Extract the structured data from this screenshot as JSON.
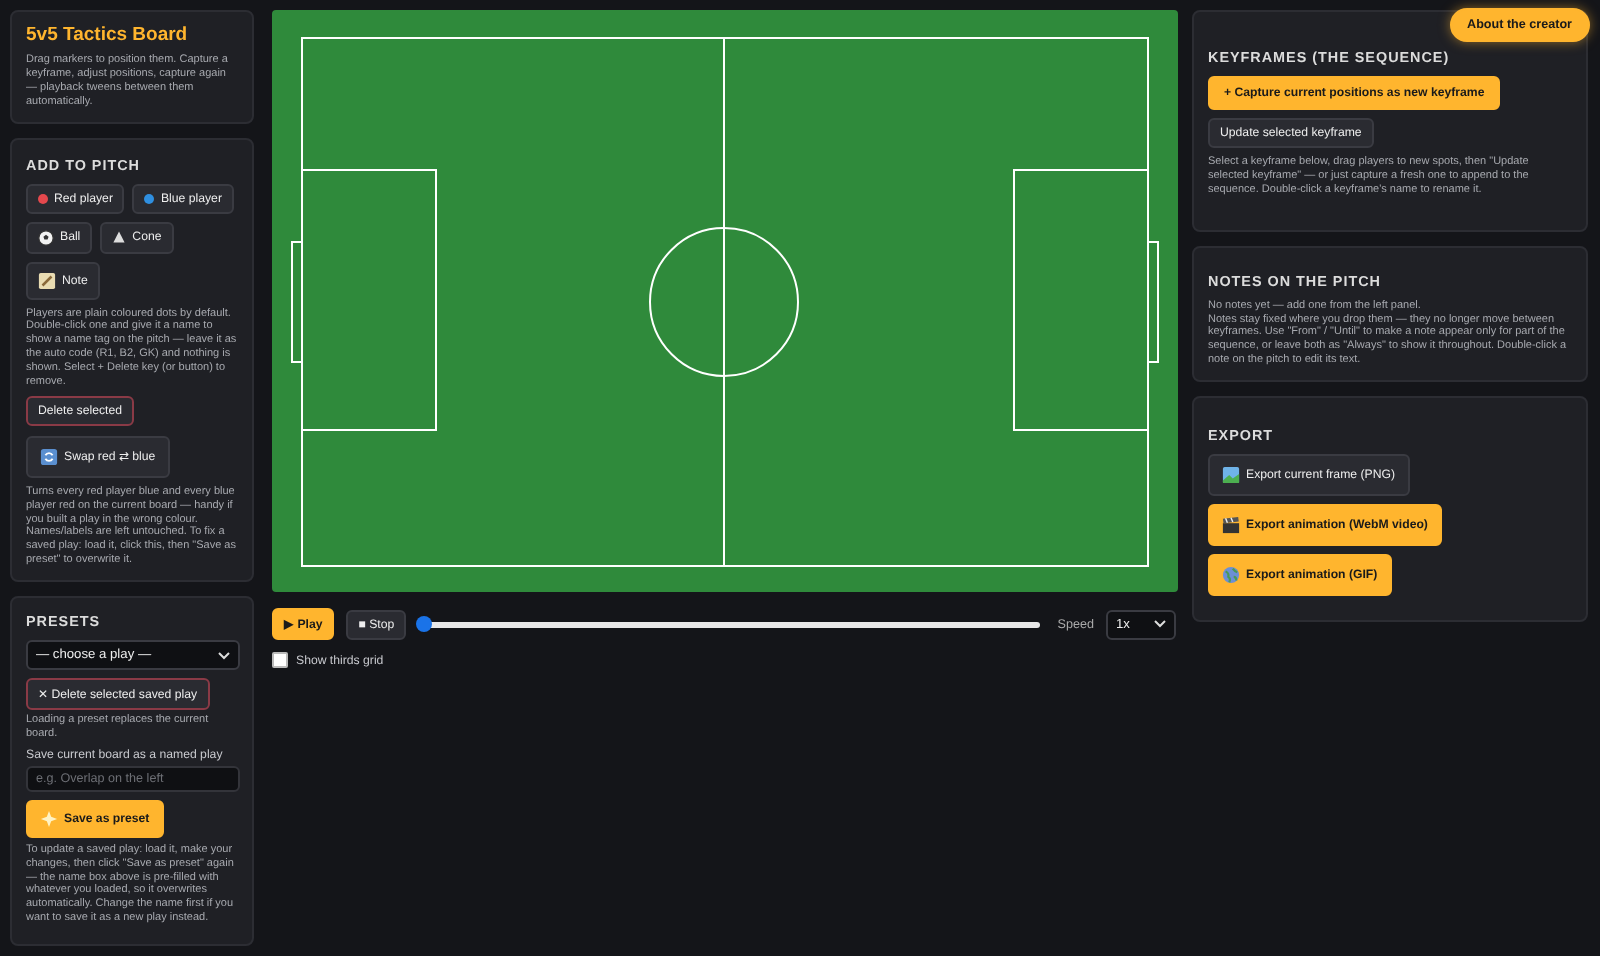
{
  "intro": {
    "title": "5v5 Tactics Board",
    "text": "Drag markers to position them. Capture a keyframe, adjust positions, capture again — playback tweens between them automatically."
  },
  "add_to_pitch": {
    "heading": "ADD TO PITCH",
    "buttons": [
      {
        "label": "Red player",
        "kind": "dot",
        "color": "#e5484d"
      },
      {
        "label": "Blue player",
        "kind": "dot",
        "color": "#2f8fe0"
      },
      {
        "label": "Ball",
        "kind": "ball"
      },
      {
        "label": "Cone",
        "kind": "cone"
      },
      {
        "label": "Note",
        "kind": "note"
      }
    ],
    "help": "Players are plain coloured dots by default. Double-click one and give it a name to show a name tag on the pitch — leave it as the auto code (R1, B2, GK) and nothing is shown. Select + Delete key (or button) to remove.",
    "delete_button": "Delete selected",
    "swap_button": "Swap red ⇄ blue",
    "swap_help": "Turns every red player blue and every blue player red on the current board — handy if you built a play in the wrong colour. Names/labels are left untouched. To fix a saved play: load it, click this, then \"Save as preset\" to overwrite it."
  },
  "presets": {
    "heading": "PRESETS",
    "select": "— choose a play —",
    "delete_button": "✕ Delete selected saved play",
    "delete_help": "Loading a preset replaces the current board.",
    "save_label": "Save current board as a named play",
    "name_field": {
      "placeholder": "e.g. Overlap on the left"
    },
    "save_button": "Save as preset",
    "help": "To update a saved play: load it, make your changes, then click \"Save as preset\" again — the name box above is pre-filled with whatever you loaded, so it overwrites automatically. Change the name first if you want to save it as a new play instead."
  },
  "playback": {
    "play_button": "▶ Play",
    "stop_button": "■ Stop",
    "timeline": {
      "level": 0
    },
    "speed_label": "Speed",
    "speed": "1x",
    "thirds_grid": {
      "label": "Show thirds grid",
      "checked": false
    }
  },
  "about_button": "About the creator",
  "keyframes": {
    "heading": "KEYFRAMES (THE SEQUENCE)",
    "capture_button": "+ Capture current positions as new keyframe",
    "update_button": "Update selected keyframe",
    "help": "Select a keyframe below, drag players to new spots, then \"Update selected keyframe\" — or just capture a fresh one to append to the sequence. Double-click a keyframe's name to rename it."
  },
  "notes": {
    "heading": "NOTES ON THE PITCH",
    "empty": "No notes yet — add one from the left panel.",
    "help": "Notes stay fixed where you drop them — they no longer move between keyframes. Use \"From\" / \"Until\" to make a note appear only for part of the sequence, or leave both as \"Always\" to show it throughout. Double-click a note on the pitch to edit its text."
  },
  "export": {
    "heading": "EXPORT",
    "buttons": [
      {
        "label": "Export current frame (PNG)",
        "kind": "default"
      },
      {
        "label": "Export animation (WebM video)",
        "kind": "primary"
      },
      {
        "label": "Export animation (GIF)",
        "kind": "primary"
      }
    ]
  }
}
